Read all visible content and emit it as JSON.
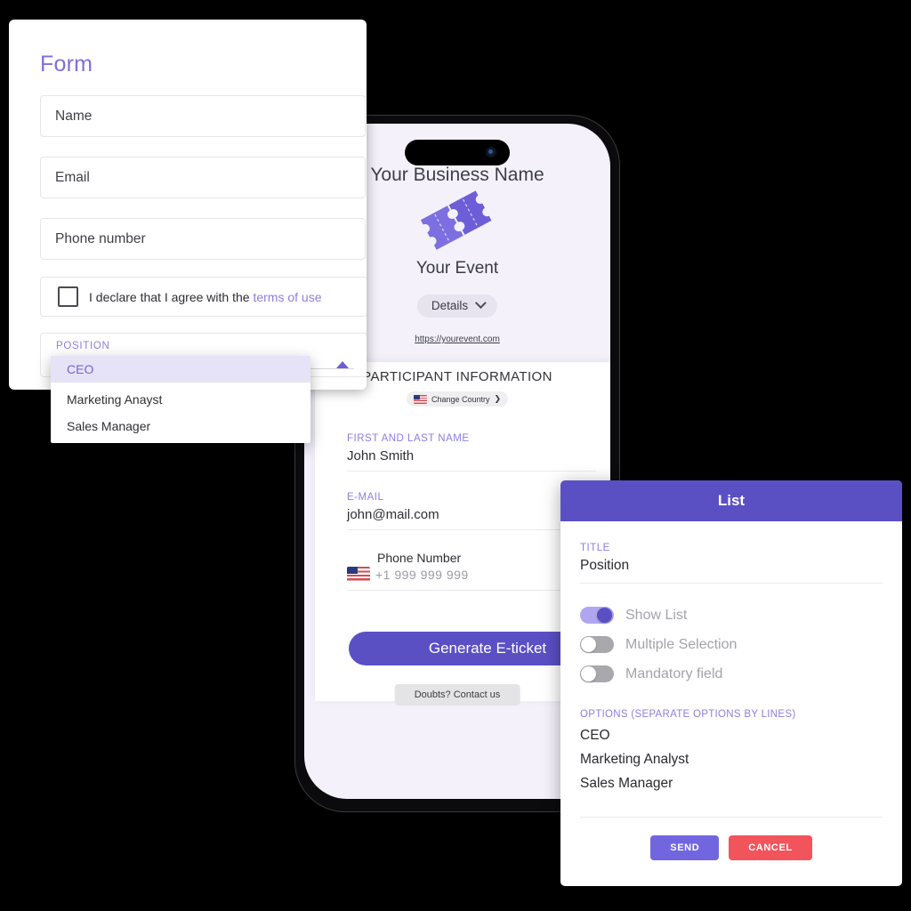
{
  "form_card": {
    "title": "Form",
    "fields": [
      {
        "name": "name",
        "placeholder": "Name"
      },
      {
        "name": "email",
        "placeholder": "Email"
      },
      {
        "name": "phone",
        "placeholder": "Phone number"
      }
    ],
    "consent": {
      "text": "I declare that I agree with the",
      "link_text": "terms of use",
      "checked": false
    },
    "select": {
      "label": "POSITION",
      "value": "CEO",
      "expanded": true,
      "caret_icon": "caret-up-icon",
      "options": [
        "CEO",
        "Marketing Anayst",
        "Sales Manager"
      ],
      "selected_index": 0
    }
  },
  "phone": {
    "business_name": "Your Business Name",
    "logo_icon": "ticket-pair-icon",
    "event_name": "Your Event",
    "details_button": "Details",
    "details_chevron_icon": "chevron-down-icon",
    "event_url": "https://yourevent.com",
    "participant": {
      "section_title": "PARTICIPANT INFORMATION",
      "change_country": "Change Country",
      "change_country_flag_icon": "us-flag-icon",
      "change_country_arrow": "❯",
      "fields": [
        {
          "label": "FIRST AND LAST NAME",
          "value": "John Smith"
        },
        {
          "label": "E-MAIL",
          "value": "john@mail.com"
        }
      ],
      "phone_label": "Phone Number",
      "phone_value": "+1 999 999 999",
      "phone_flag_icon": "us-flag-icon"
    },
    "generate_button": "Generate E-ticket",
    "contact_button": "Doubts? Contact us"
  },
  "list_panel": {
    "header_title": "List",
    "title_label": "TITLE",
    "title_value": "Position",
    "toggles": [
      {
        "label": "Show List",
        "on": true
      },
      {
        "label": "Multiple Selection",
        "on": false
      },
      {
        "label": "Mandatory field",
        "on": false
      }
    ],
    "options_label": "OPTIONS (SEPARATE OPTIONS BY LINES)",
    "options": [
      "CEO",
      "Marketing Analyst",
      "Sales Manager"
    ],
    "send_button": "SEND",
    "cancel_button": "CANCEL"
  },
  "colors": {
    "background": "#000000",
    "primary_purple": "#5b4fc4",
    "accent_purple": "#8c7fe0",
    "send_purple": "#7265e0",
    "cancel_red": "#f2545b",
    "phone_screen": "#f4f1fb"
  }
}
